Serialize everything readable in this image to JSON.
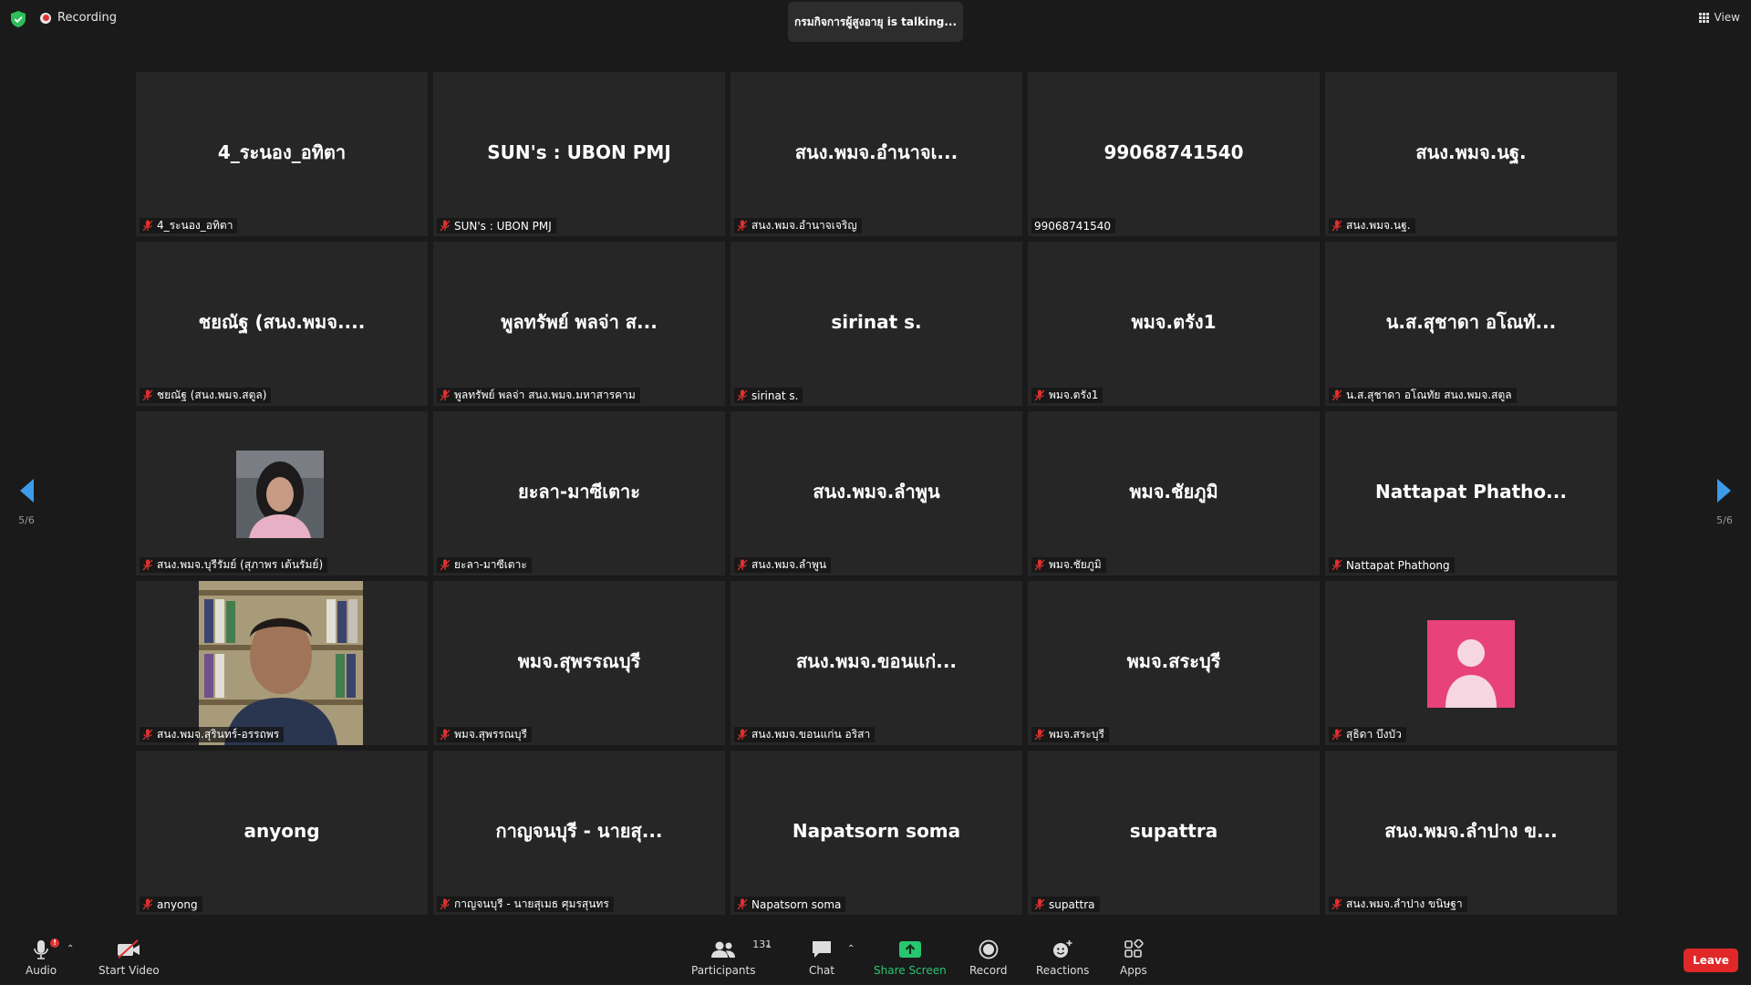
{
  "top": {
    "recording_label": "Recording",
    "talking_text": "กรมกิจการผู้สูงอายุ is talking...",
    "view_label": "View"
  },
  "pagination": {
    "left": "5/6",
    "right": "5/6"
  },
  "tiles": [
    {
      "display": "4_ระนอง_อทิตา",
      "name": "4_ระนอง_อทิตา"
    },
    {
      "display": "SUN's : UBON PMJ",
      "name": "SUN's : UBON PMJ"
    },
    {
      "display": "สนง.พมจ.อำนาจเ...",
      "name": "สนง.พมจ.อำนาจเจริญ"
    },
    {
      "display": "99068741540",
      "name": "99068741540"
    },
    {
      "display": "สนง.พมจ.นฐ.",
      "name": "สนง.พมจ.นฐ."
    },
    {
      "display": "ชยณัฐ (สนง.พมจ....",
      "name": "ชยณัฐ (สนง.พมจ.สตูล)"
    },
    {
      "display": "พูลทรัพย์ พลจ่า ส...",
      "name": "พูลทรัพย์ พลจ่า สนง.พมจ.มหาสารคาม"
    },
    {
      "display": "sirinat s.",
      "name": "sirinat s."
    },
    {
      "display": "พมจ.ตรัง1",
      "name": "พมจ.ตรัง1"
    },
    {
      "display": "น.ส.สุชาดา อโณทั...",
      "name": "น.ส.สุชาดา อโณทัย สนง.พมจ.สตูล"
    },
    {
      "display": "",
      "name": "สนง.พมจ.บุรีรัมย์ (สุภาพร เต้นรัมย์)"
    },
    {
      "display": "ยะลา-มาซีเตาะ",
      "name": "ยะลา-มาซีเตาะ"
    },
    {
      "display": "สนง.พมจ.ลำพูน",
      "name": "สนง.พมจ.ลำพูน"
    },
    {
      "display": "พมจ.ชัยภูมิ",
      "name": "พมจ.ชัยภูมิ"
    },
    {
      "display": "Nattapat Phatho...",
      "name": "Nattapat Phathong"
    },
    {
      "display": "",
      "name": "สนง.พมจ.สุรินทร์-อรรถพร"
    },
    {
      "display": "พมจ.สุพรรณบุรี",
      "name": "พมจ.สุพรรณบุรี"
    },
    {
      "display": "สนง.พมจ.ขอนแก่...",
      "name": "สนง.พมจ.ขอนแก่น อริสา"
    },
    {
      "display": "พมจ.สระบุรี",
      "name": "พมจ.สระบุรี"
    },
    {
      "display": "",
      "name": "สุธิดา บึงบัว"
    },
    {
      "display": "anyong",
      "name": "anyong"
    },
    {
      "display": "กาญจนบุรี - นายสุ...",
      "name": "กาญจนบุรี - นายสุเมธ ศุมรสุนทร"
    },
    {
      "display": "Napatsorn soma",
      "name": "Napatsorn soma"
    },
    {
      "display": "supattra",
      "name": "supattra"
    },
    {
      "display": "สนง.พมจ.ลำปาง ข...",
      "name": "สนง.พมจ.ลำปาง ขนิษฐา"
    }
  ],
  "toolbar": {
    "audio": "Audio",
    "audio_badge": "!",
    "start_video": "Start Video",
    "participants": "Participants",
    "participants_count": "131",
    "chat": "Chat",
    "share_screen": "Share Screen",
    "record": "Record",
    "reactions": "Reactions",
    "apps": "Apps",
    "leave": "Leave"
  },
  "colors": {
    "background": "#1a1a1a",
    "tile": "#262626",
    "share_green": "#28c76f",
    "leave_red": "#e02828",
    "avatar_pink": "#e8427b",
    "arrow_blue": "#3d9be9"
  }
}
